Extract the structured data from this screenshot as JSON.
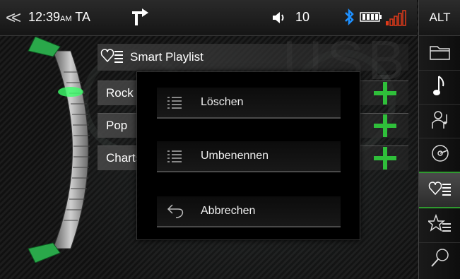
{
  "status": {
    "time": "12:39",
    "ampm": "AM",
    "ta": "TA",
    "volume": "10",
    "alt_label": "ALT",
    "colors": {
      "bluetooth": "#1e90ff",
      "signal_bars": "#e03a1a",
      "accent": "#2fbf3a"
    }
  },
  "background": {
    "source_label": "USB"
  },
  "list": {
    "header": {
      "title": "Smart Playlist",
      "icon": "heart-list-icon"
    },
    "rows": [
      {
        "label": "Rock"
      },
      {
        "label": "Pop"
      },
      {
        "label": "Charts"
      }
    ]
  },
  "popup": {
    "items": [
      {
        "label": "Löschen",
        "icon": "list-icon"
      },
      {
        "label": "Umbenennen",
        "icon": "list-icon"
      },
      {
        "label": "Abbrechen",
        "icon": "undo-arrow-icon"
      }
    ]
  },
  "rail": {
    "items": [
      {
        "icon": "folder-icon"
      },
      {
        "icon": "music-note-icon"
      },
      {
        "icon": "artist-icon"
      },
      {
        "icon": "album-disc-icon"
      },
      {
        "icon": "heart-list-icon",
        "active": true
      },
      {
        "icon": "star-list-icon"
      },
      {
        "icon": "search-icon"
      }
    ]
  }
}
